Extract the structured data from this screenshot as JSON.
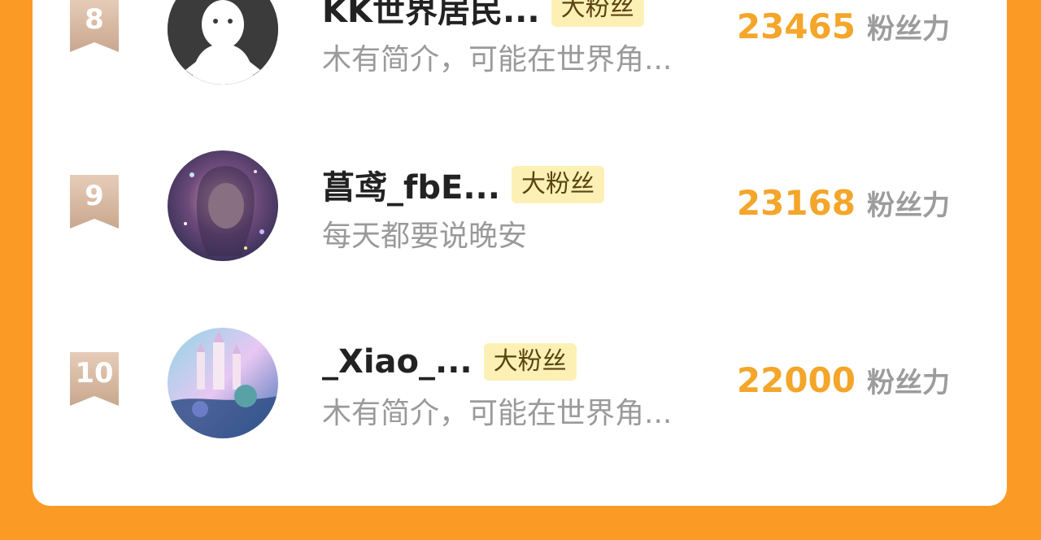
{
  "entries": [
    {
      "rank": "8",
      "name": "KK世界居民...",
      "tag": "大粉丝",
      "bio": "木有简介，可能在世界角...",
      "score": "23465",
      "unit": "粉丝力"
    },
    {
      "rank": "9",
      "name": "菖鸢_fbE...",
      "tag": "大粉丝",
      "bio": "每天都要说晚安",
      "score": "23168",
      "unit": "粉丝力"
    },
    {
      "rank": "10",
      "name": "_Xiao_...",
      "tag": "大粉丝",
      "bio": "木有简介，可能在世界角...",
      "score": "22000",
      "unit": "粉丝力"
    }
  ],
  "colors": {
    "background": "#fb9a25",
    "score": "#f3a62a",
    "tag_bg": "#fdf0b5",
    "badge": "#d6b8a2"
  }
}
